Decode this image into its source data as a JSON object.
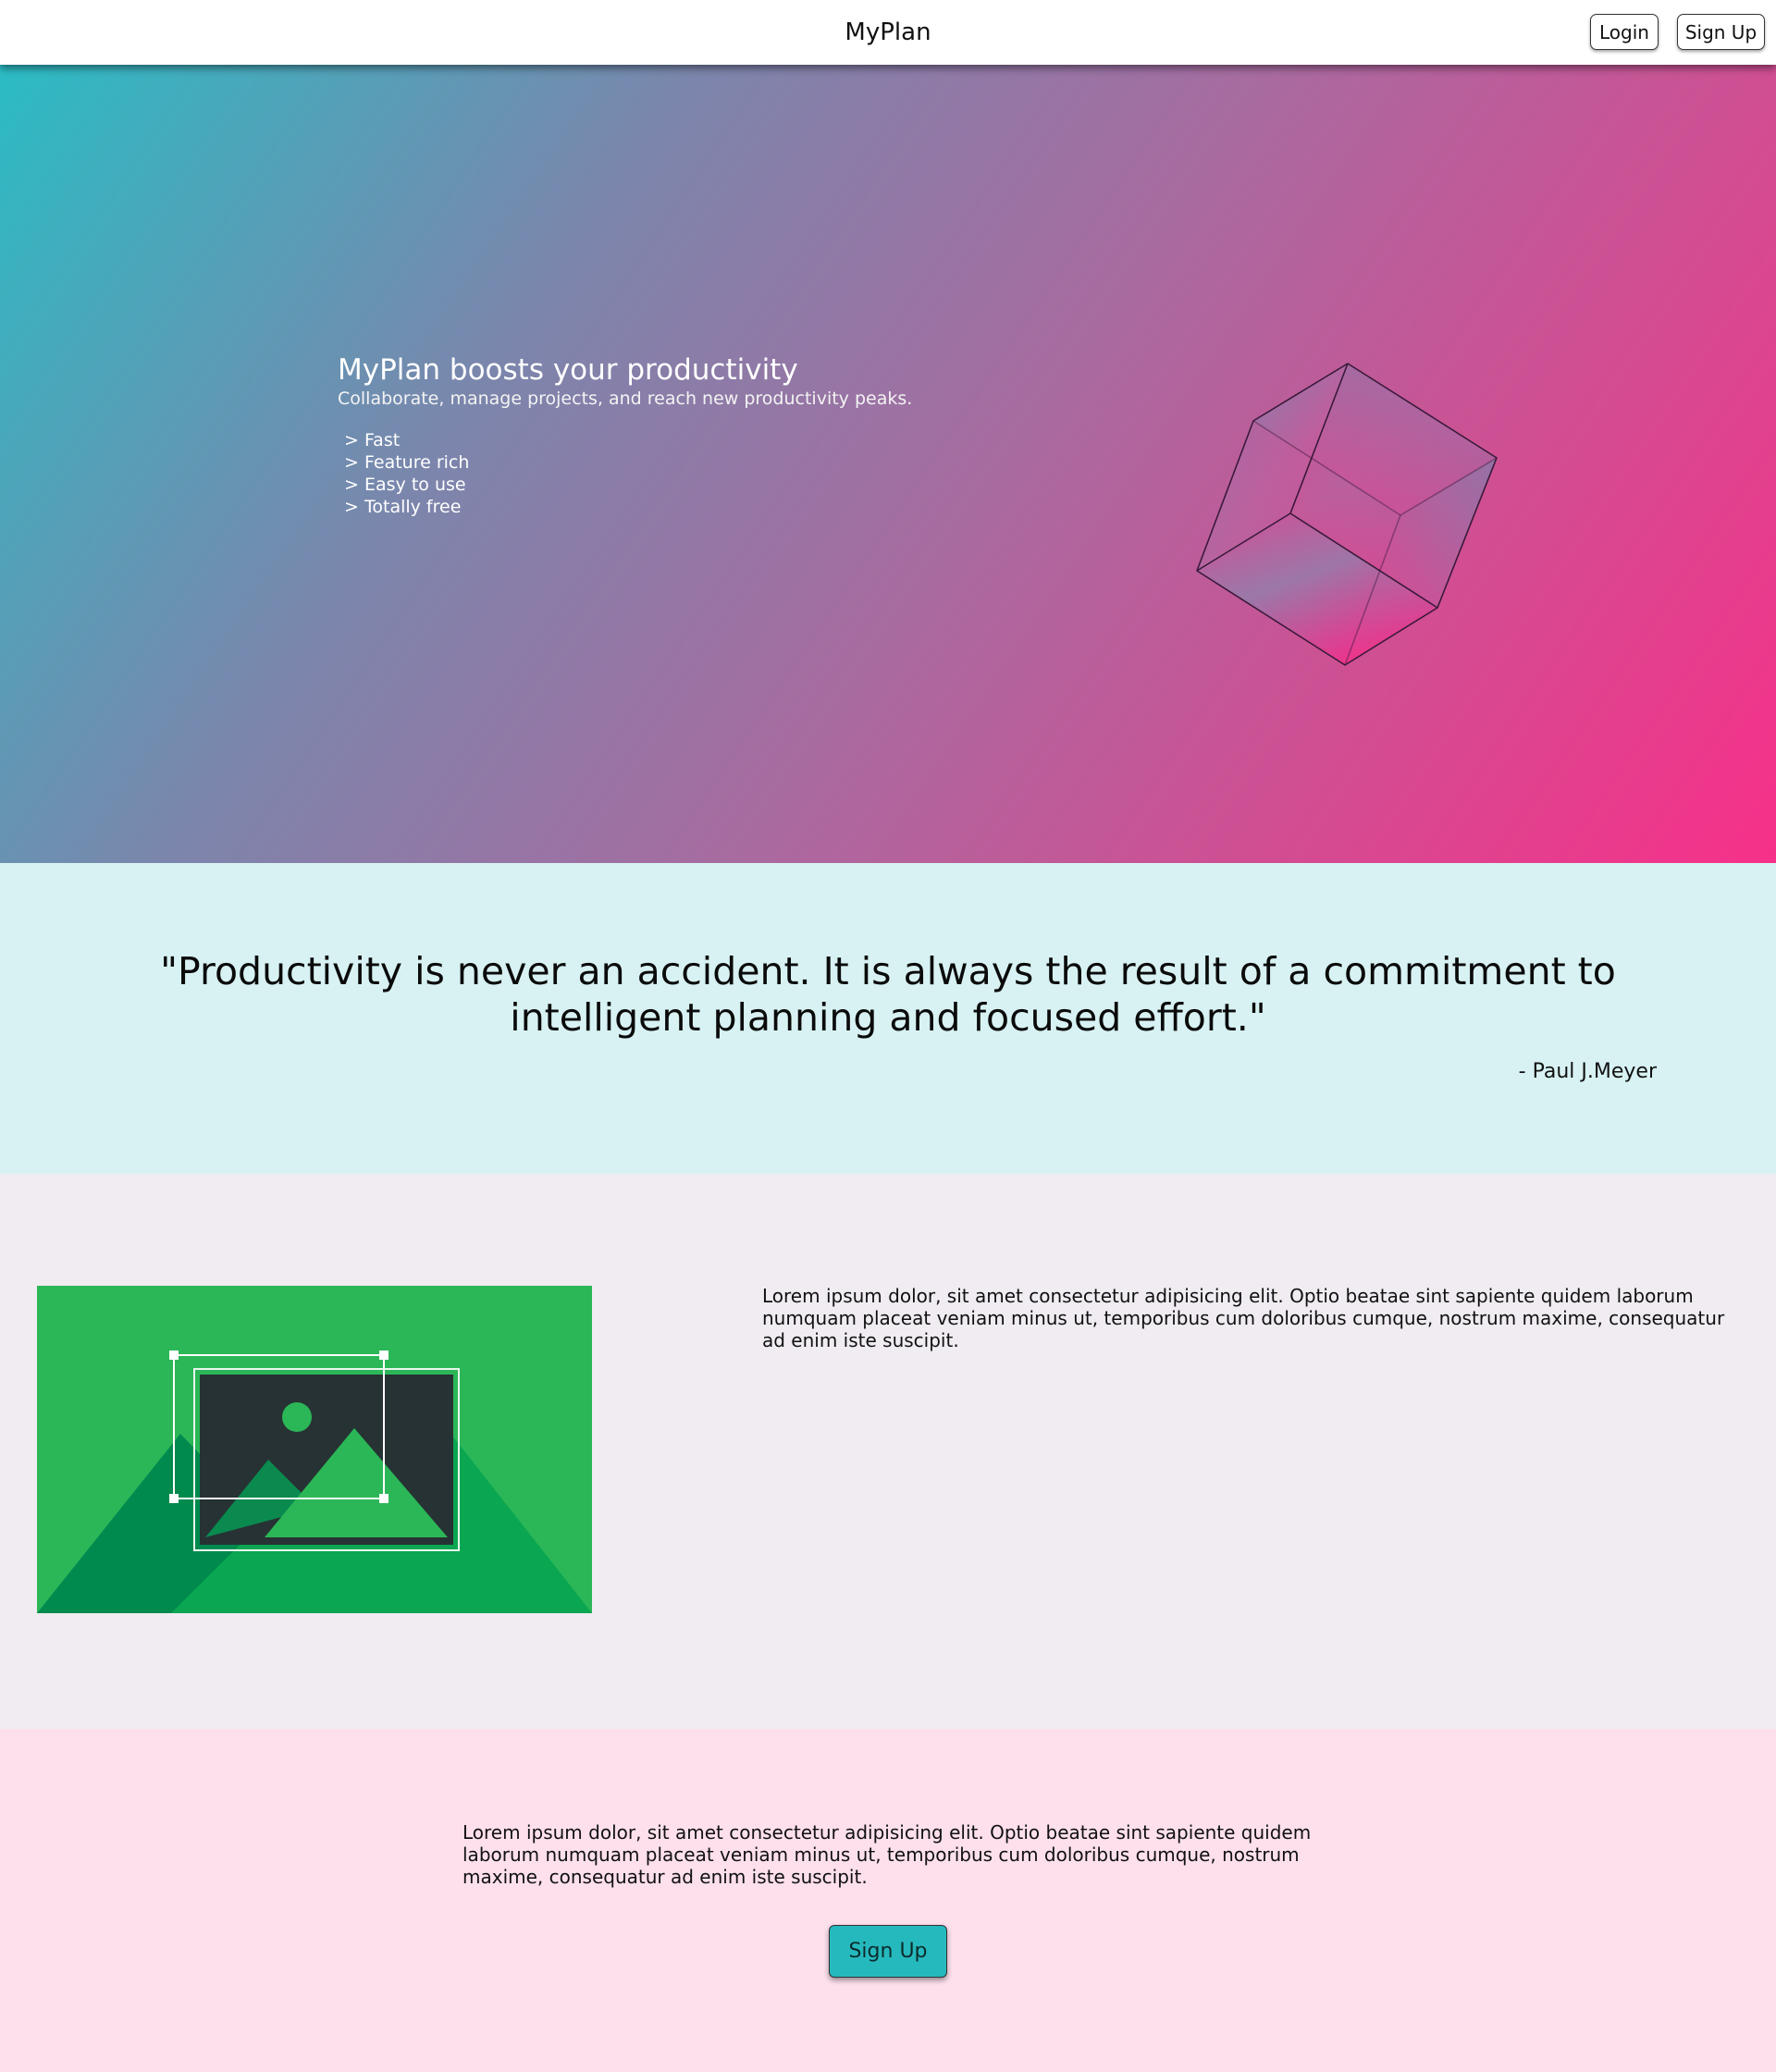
{
  "header": {
    "brand": "MyPlan",
    "login_label": "Login",
    "signup_label": "Sign Up"
  },
  "hero": {
    "title": "MyPlan boosts your productivity",
    "subtitle": "Collaborate, manage projects, and reach new productivity peaks.",
    "bullet_marker": ">",
    "features": [
      "Fast",
      "Feature rich",
      "Easy to use",
      "Totally free"
    ],
    "gradient_colors": [
      "#2bbcc4",
      "#f7308a"
    ],
    "cube_icon": "cube-icon"
  },
  "quote": {
    "text": "\"Productivity is never an accident. It is always the result of a commitment to intelligent planning and focused effort.\"",
    "author": "- Paul J.Meyer"
  },
  "feature_section": {
    "illustration_icon": "image-crop-illustration",
    "text": "Lorem ipsum dolor, sit amet consectetur adipisicing elit. Optio beatae sint sapiente quidem laborum numquam placeat veniam minus ut, temporibus cum doloribus cumque, nostrum maxime, consequatur ad enim iste suscipit."
  },
  "cta": {
    "text": "Lorem ipsum dolor, sit amet consectetur adipisicing elit. Optio beatae sint sapiente quidem laborum numquam placeat veniam minus ut, temporibus cum doloribus cumque, nostrum maxime, consequatur ad enim iste suscipit.",
    "button_label": "Sign Up",
    "button_color": "#25b9be"
  }
}
